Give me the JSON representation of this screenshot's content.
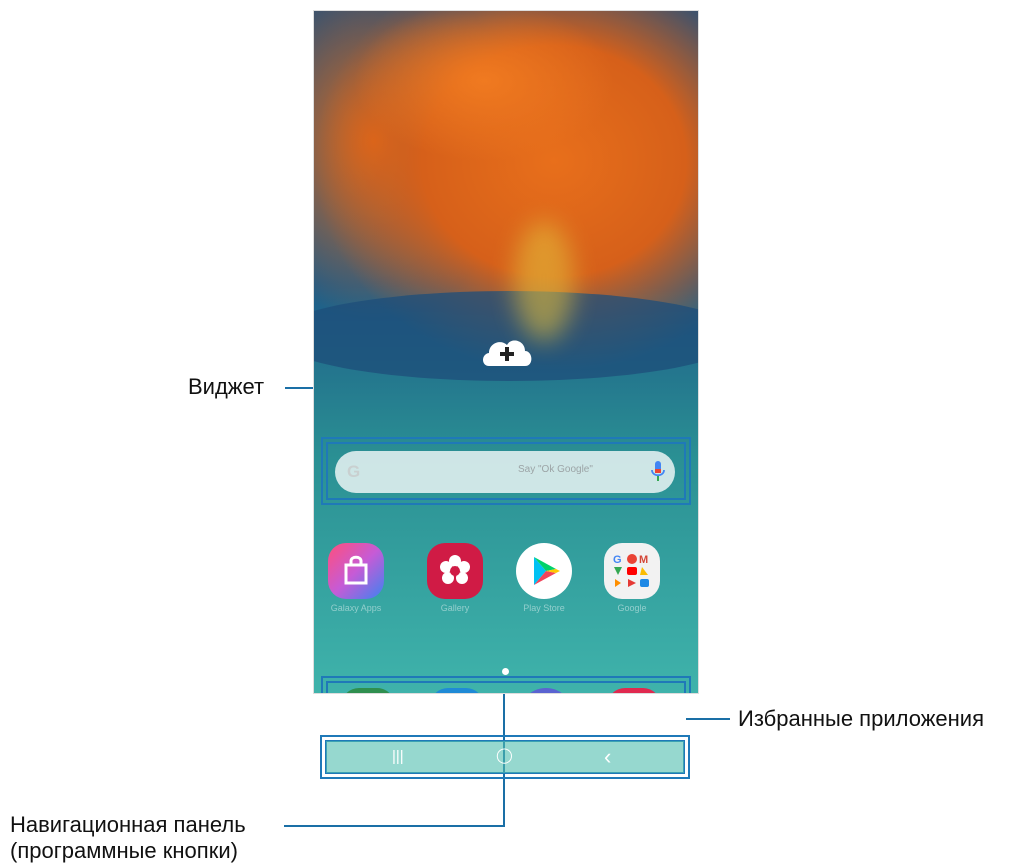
{
  "callouts": {
    "widget": "Виджет",
    "favorites": "Избранные приложения",
    "navbar_line1": "Навигационная панель",
    "navbar_line2": "(программные кнопки)"
  },
  "widget": {
    "search_hint": "Say \"Ok Google\"",
    "logo_letter": "G"
  },
  "apps": [
    {
      "name": "Galaxy Apps",
      "icon": "galaxy-store-icon",
      "color": "#f05a8a"
    },
    {
      "name": "Gallery",
      "icon": "gallery-icon",
      "color": "#d01b45"
    },
    {
      "name": "Play Store",
      "icon": "play-store-icon",
      "color": "#ffffff"
    },
    {
      "name": "Google",
      "icon": "google-folder-icon",
      "color": "#f2f2f2"
    }
  ],
  "dock": [
    {
      "icon": "phone-icon",
      "color": "#2f8f4f"
    },
    {
      "icon": "messages-icon",
      "color": "#1f8ad6"
    },
    {
      "icon": "internet-icon",
      "color": "#5a63d1"
    },
    {
      "icon": "camera-icon",
      "color": "#e0294f"
    }
  ],
  "navigation": {
    "recents": "|||",
    "home": "◯",
    "back": "‹"
  },
  "colors": {
    "callout_line": "#1a6fa6",
    "frame": "#1f79b8"
  }
}
